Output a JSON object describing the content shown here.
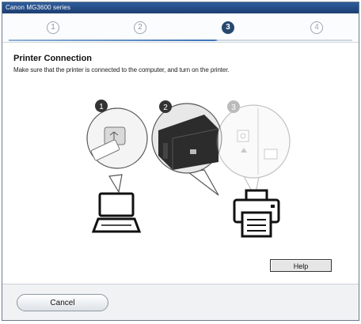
{
  "window": {
    "title": "Canon MG3600 series"
  },
  "steps": [
    {
      "label": "1",
      "state": "done"
    },
    {
      "label": "2",
      "state": "done"
    },
    {
      "label": "3",
      "state": "active"
    },
    {
      "label": "4",
      "state": "upcoming"
    }
  ],
  "page": {
    "heading": "Printer Connection",
    "description": "Make sure that the printer is connected to the computer, and turn on the printer."
  },
  "illustration": {
    "badges": [
      "1",
      "2",
      "3"
    ],
    "icons": [
      "usb-plug-icon",
      "printer-rear-port-icon",
      "printer-power-panel-icon",
      "laptop-icon",
      "printer-icon"
    ]
  },
  "buttons": {
    "help": "Help",
    "cancel": "Cancel"
  },
  "colors": {
    "titlebar": "#2f5d9d",
    "active_step": "#26486e",
    "progress": "#3d73b7"
  }
}
